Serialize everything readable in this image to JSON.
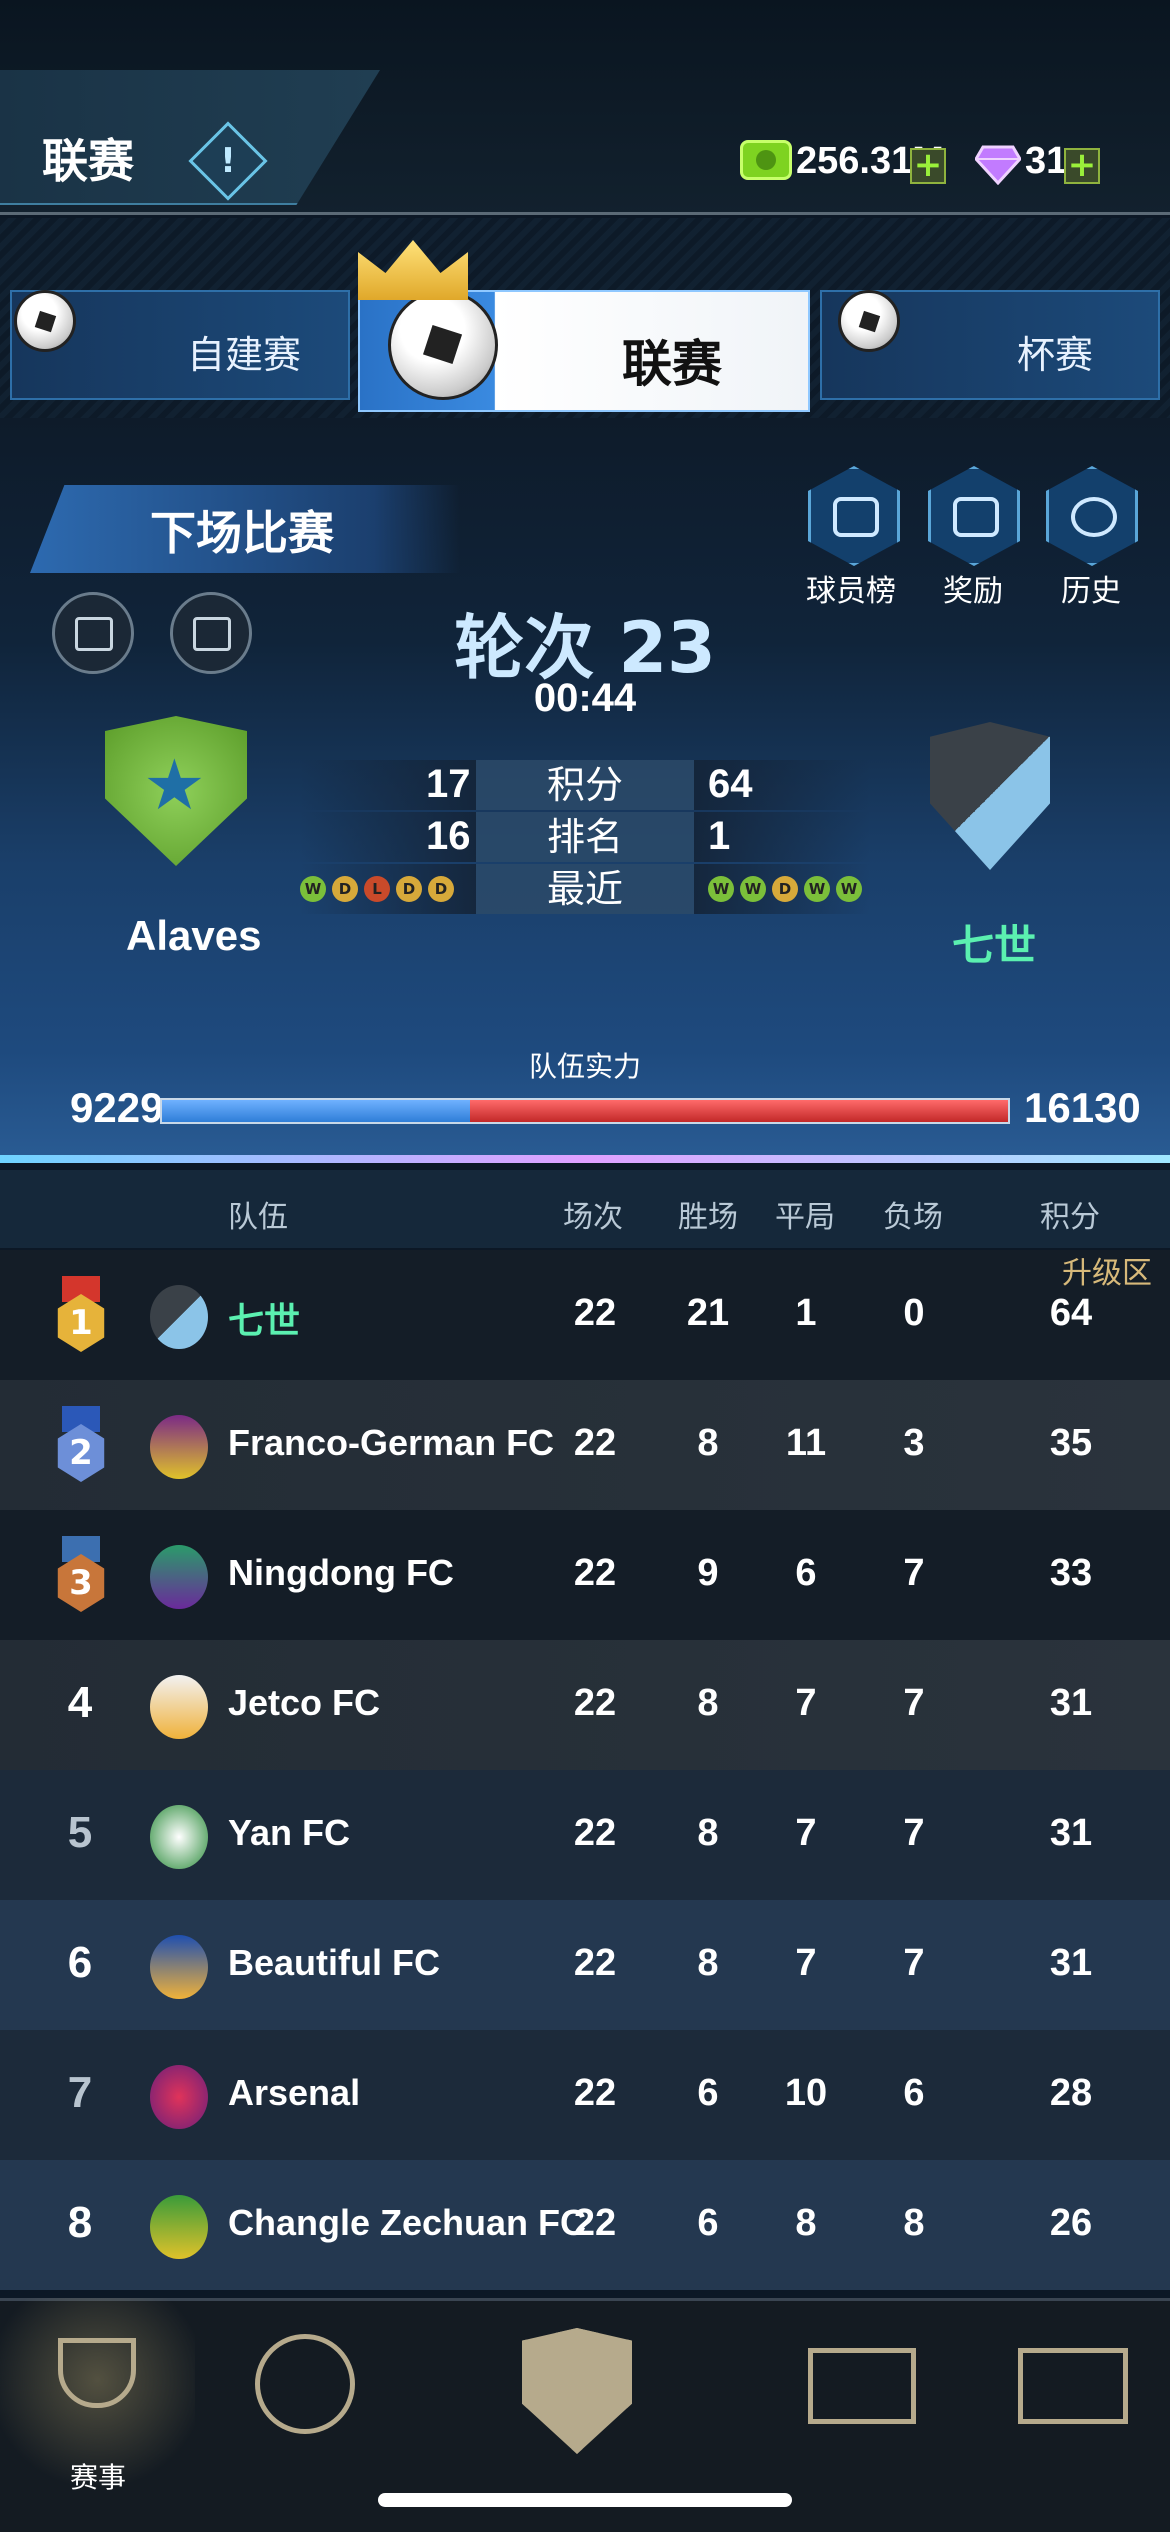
{
  "header": {
    "title": "联赛",
    "info_icon": "info-icon",
    "money": {
      "icon": "cash-icon",
      "value": "256.31M"
    },
    "gems": {
      "icon": "diamond-icon",
      "value": "31"
    }
  },
  "mode_tabs": [
    {
      "label": "自建赛",
      "icon": "ball-icon"
    },
    {
      "label": "联赛",
      "icon": "crowned-ball-icon",
      "selected": true
    },
    {
      "label": "杯赛",
      "icon": "trophy-ball-icon"
    }
  ],
  "next_match": {
    "banner": "下场比赛",
    "actions": [
      {
        "label": "球员榜",
        "icon": "players-icon"
      },
      {
        "label": "奖励",
        "icon": "gift-icon"
      },
      {
        "label": "历史",
        "icon": "medal-icon"
      }
    ],
    "round_label": "轮次 23",
    "time": "00:44",
    "home": {
      "name": "Alaves",
      "points": "17",
      "rank": "16",
      "form": [
        "W",
        "D",
        "L",
        "D",
        "D"
      ]
    },
    "away": {
      "name": "七世",
      "points": "64",
      "rank": "1",
      "form": [
        "W",
        "W",
        "D",
        "W",
        "W"
      ]
    },
    "stat_labels": {
      "points": "积分",
      "rank": "排名",
      "recent": "最近"
    },
    "strength": {
      "label": "队伍实力",
      "home": "9229",
      "away": "16130",
      "home_fraction": 0.364
    }
  },
  "standings": {
    "headers": {
      "team": "队伍",
      "played": "场次",
      "won": "胜场",
      "drawn": "平局",
      "lost": "负场",
      "points": "积分"
    },
    "promotion_label": "升级区",
    "rows": [
      {
        "rank": "1",
        "team": "七世",
        "played": "22",
        "won": "21",
        "drawn": "1",
        "lost": "0",
        "points": "64",
        "highlight": true
      },
      {
        "rank": "2",
        "team": "Franco-German FC",
        "played": "22",
        "won": "8",
        "drawn": "11",
        "lost": "3",
        "points": "35"
      },
      {
        "rank": "3",
        "team": "Ningdong FC",
        "played": "22",
        "won": "9",
        "drawn": "6",
        "lost": "7",
        "points": "33"
      },
      {
        "rank": "4",
        "team": "Jetco FC",
        "played": "22",
        "won": "8",
        "drawn": "7",
        "lost": "7",
        "points": "31"
      },
      {
        "rank": "5",
        "team": "Yan FC",
        "played": "22",
        "won": "8",
        "drawn": "7",
        "lost": "7",
        "points": "31"
      },
      {
        "rank": "6",
        "team": "Beautiful FC",
        "played": "22",
        "won": "8",
        "drawn": "7",
        "lost": "7",
        "points": "31"
      },
      {
        "rank": "7",
        "team": "Arsenal",
        "played": "22",
        "won": "6",
        "drawn": "10",
        "lost": "6",
        "points": "28"
      },
      {
        "rank": "8",
        "team": "Changle Zechuan FC",
        "played": "22",
        "won": "6",
        "drawn": "8",
        "lost": "8",
        "points": "26"
      }
    ]
  },
  "bottom_nav": {
    "active_label": "赛事",
    "items": [
      "trophy-icon",
      "globe-icon",
      "club-crest-icon",
      "pitch-icon",
      "goal-icon"
    ]
  }
}
